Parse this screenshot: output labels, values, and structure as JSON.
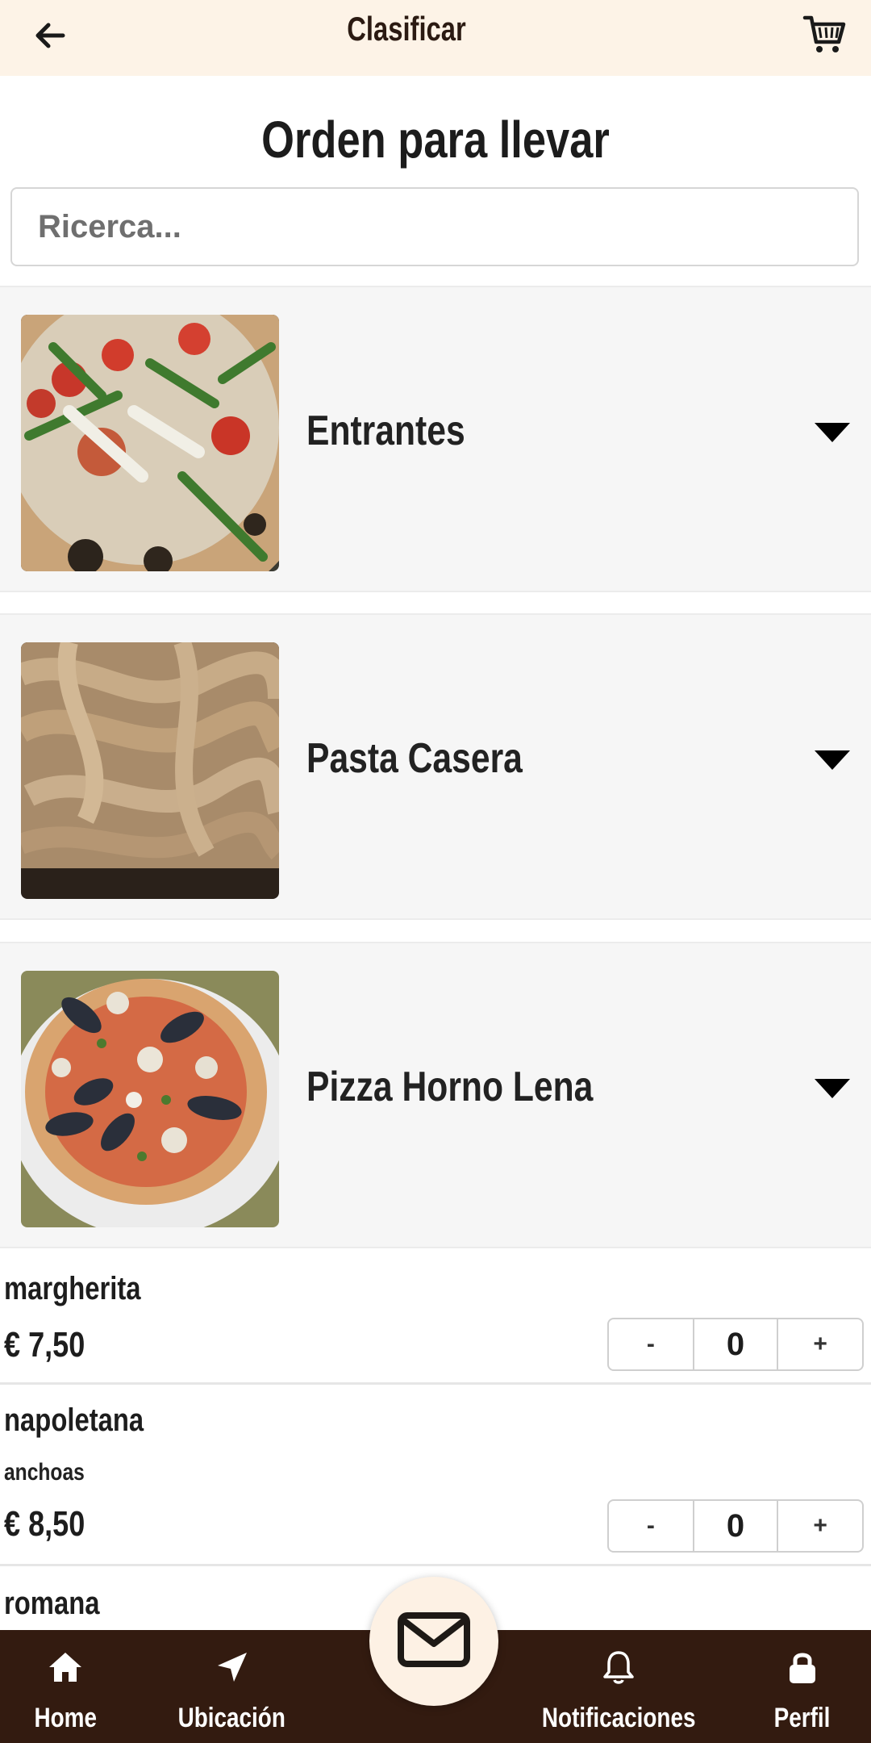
{
  "header": {
    "title": "Clasificar",
    "back_icon": "arrow-left-icon",
    "cart_icon": "cart-icon"
  },
  "page": {
    "title": "Orden para llevar"
  },
  "search": {
    "placeholder": "Ricerca..."
  },
  "categories": [
    {
      "label": "Entrantes",
      "image": "pizza-arugula-image",
      "icon": "caret-down-icon"
    },
    {
      "label": "Pasta Casera",
      "image": "fresh-pasta-image",
      "icon": "caret-down-icon"
    },
    {
      "label": "Pizza Horno Lena",
      "image": "seafood-pizza-image",
      "icon": "caret-down-icon"
    }
  ],
  "items": [
    {
      "name": "margherita",
      "description": "",
      "price": "€ 7,50",
      "qty": "0",
      "minus": "-",
      "plus": "+"
    },
    {
      "name": "napoletana",
      "description": "anchoas",
      "price": "€ 8,50",
      "qty": "0",
      "minus": "-",
      "plus": "+"
    },
    {
      "name": "romana"
    }
  ],
  "bottom_nav": [
    {
      "label": "Home",
      "icon": "home-icon"
    },
    {
      "label": "Ubicación",
      "icon": "location-arrow-icon"
    },
    {
      "label": "Notificaciones",
      "icon": "bell-icon"
    },
    {
      "label": "Perfil",
      "icon": "lock-icon"
    }
  ],
  "fab": {
    "icon": "envelope-icon"
  },
  "colors": {
    "header_bg": "#fdf3e7",
    "nav_bg": "#331b10",
    "category_bg": "#f6f6f6",
    "fab_bg": "#fdf1e4"
  }
}
